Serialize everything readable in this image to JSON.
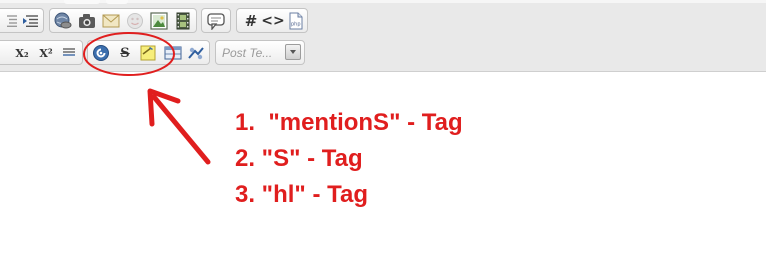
{
  "toolbar": {
    "row1": [
      {
        "id": "outdent",
        "icon": "outdent-icon"
      },
      {
        "id": "indent",
        "icon": "indent-icon"
      },
      {
        "id": "link",
        "icon": "link-globe-icon"
      },
      {
        "id": "image",
        "icon": "camera-icon"
      },
      {
        "id": "email",
        "icon": "envelope-icon"
      },
      {
        "id": "smilie",
        "icon": "smilie-icon"
      },
      {
        "id": "picture",
        "icon": "picture-frame-icon"
      },
      {
        "id": "media",
        "icon": "film-strip-icon"
      },
      {
        "id": "quote",
        "icon": "speech-bubble-icon"
      },
      {
        "id": "hash",
        "label": "#",
        "icon": "hash-icon"
      },
      {
        "id": "code",
        "label": "<>",
        "icon": "code-brackets-icon"
      },
      {
        "id": "php",
        "label": "php",
        "icon": "php-file-icon"
      }
    ],
    "row2": [
      {
        "id": "subscript",
        "label": "X₂",
        "icon": "subscript-icon"
      },
      {
        "id": "superscript",
        "label": "X²",
        "icon": "superscript-icon"
      },
      {
        "id": "align",
        "icon": "lines-icon"
      },
      {
        "id": "mentions",
        "icon": "mention-swirl-icon"
      },
      {
        "id": "strike",
        "label": "S",
        "icon": "strikethrough-icon"
      },
      {
        "id": "highlight",
        "icon": "highlight-note-icon"
      },
      {
        "id": "table",
        "icon": "table-icon"
      },
      {
        "id": "special",
        "icon": "special-icon"
      }
    ],
    "post_template": {
      "value": "Post Te..."
    }
  },
  "annotations": [
    "1.  \"mentionS\" - Tag",
    "2. \"S\" - Tag",
    "3. \"hl\" - Tag"
  ],
  "colors": {
    "annotation": "#e01e1e",
    "toolbar_bg": "#e9e9e9",
    "editor_bg": "#ffffff"
  }
}
